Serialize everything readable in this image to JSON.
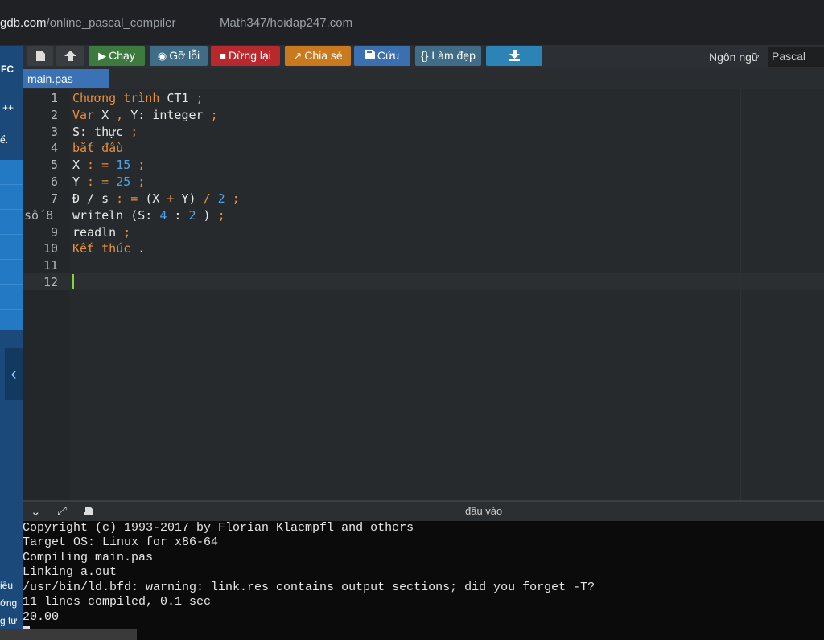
{
  "address_bar": {
    "url_domain": "gdb.com",
    "url_path": "/online_pascal_compiler",
    "bookmark": "Math347/hoidap247.com"
  },
  "sidebar": {
    "logo": "FC",
    "cpp": "++",
    "note": "ể.",
    "bottom": [
      "iều",
      "ớng",
      "g tư"
    ]
  },
  "toolbar": {
    "run": "Chạy",
    "debug": "Gỡ lỗi",
    "stop": "Dừng lại",
    "share": "Chia sẻ",
    "save": "Cứu",
    "beautify": "{} Làm đẹp",
    "language_label": "Ngôn ngữ",
    "language_value": "Pascal"
  },
  "tab": {
    "filename": "main.pas"
  },
  "editor": {
    "line_numbers": [
      "1",
      "2",
      "3",
      "4",
      "5",
      "6",
      "7",
      "số 8",
      "9",
      "10",
      "11",
      "12"
    ]
  },
  "output_pane": {
    "title": "đầu vào",
    "lines": [
      "Copyright (c) 1993-2017 by Florian Klaempfl and others",
      "Target OS: Linux for x86-64",
      "Compiling main.pas",
      "Linking a.out",
      "/usr/bin/ld.bfd: warning: link.res contains output sections; did you forget -T?",
      "11 lines compiled, 0.1 sec",
      "20.00"
    ]
  },
  "colors": {
    "keyword": "#e78f3c",
    "number": "#4ea3e8",
    "run_button": "#3d7a3d",
    "stop_button": "#b9282c",
    "share_button": "#c97a1f",
    "tab_active": "#3a72b5",
    "cursor": "#7fd63a"
  },
  "icons": {
    "new_file": "file-icon",
    "upload": "upload-icon",
    "run": "play-icon",
    "debug": "debug-icon",
    "stop": "stop-icon",
    "share": "share-icon",
    "save": "save-icon",
    "download": "download-icon",
    "collapse": "chevron-left-icon",
    "output_collapse": "chevron-down-icon",
    "output_expand": "expand-icon",
    "output_clear": "eraser-icon"
  }
}
